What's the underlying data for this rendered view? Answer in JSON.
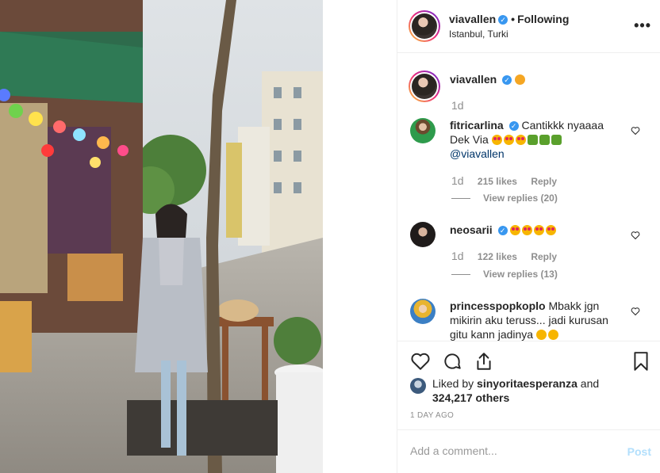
{
  "post": {
    "author": "viavallen",
    "follow_status": "Following",
    "location": "Istanbul, Turki",
    "more_icon": "more-horizontal-icon"
  },
  "caption": {
    "author": "viavallen",
    "time": "1d"
  },
  "comments": [
    {
      "user": "fitricarlina",
      "verified": true,
      "text": "Cantikkk nyaaaa Dek Via",
      "mention": "@viavallen",
      "time": "1d",
      "likes": "215 likes",
      "reply_label": "Reply",
      "view_replies": "View replies (20)"
    },
    {
      "user": "neosarii",
      "verified": true,
      "text": "",
      "time": "1d",
      "likes": "122 likes",
      "reply_label": "Reply",
      "view_replies": "View replies (13)"
    },
    {
      "user": "princesspopkoplo",
      "verified": false,
      "text_line1": "Mbakk jgn",
      "text_line2": "mikirin aku teruss... jadi kurusan",
      "text_line3": "gitu kann jadinya"
    }
  ],
  "likes": {
    "prefix": "Liked by",
    "user": "sinyoritaesperanza",
    "conj": "and",
    "others": "324,217 others"
  },
  "timestamp": "1 DAY AGO",
  "add_comment": {
    "placeholder": "Add a comment...",
    "post_label": "Post"
  },
  "colors": {
    "verified": "#3897f0",
    "post_disabled": "#b2dffc",
    "meta": "#8e8e8e"
  }
}
